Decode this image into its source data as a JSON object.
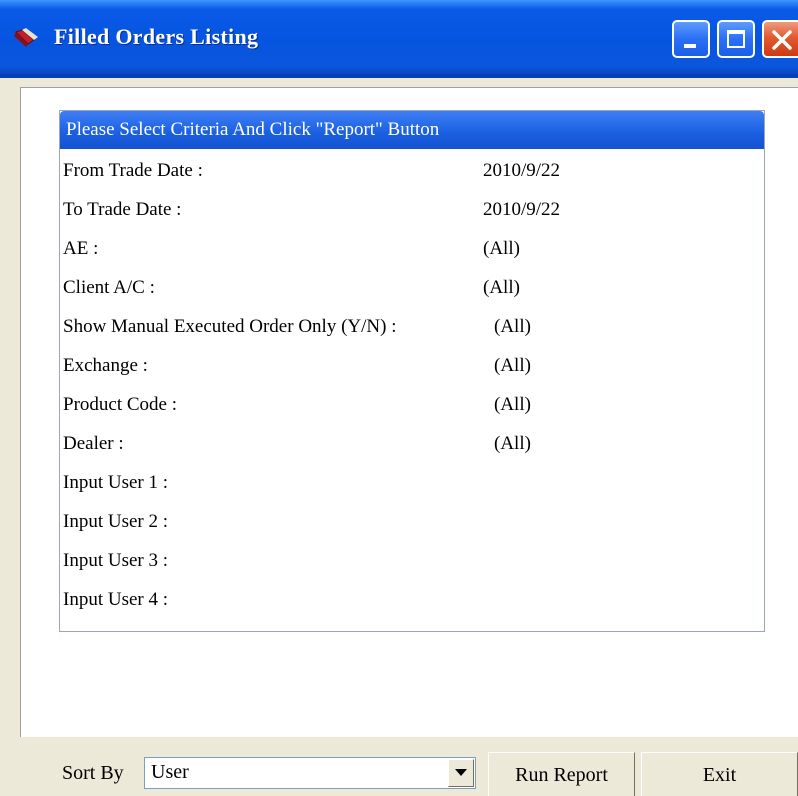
{
  "window": {
    "title": "Filled Orders Listing"
  },
  "criteria": {
    "header": "Please Select Criteria And Click \"Report\" Button",
    "rows": [
      {
        "label": "From Trade Date :",
        "value": "2010/9/22"
      },
      {
        "label": "To Trade Date :",
        "value": "2010/9/22"
      },
      {
        "label": "AE :",
        "value": "(All)"
      },
      {
        "label": "Client A/C :",
        "value": "(All)"
      },
      {
        "label": "Show Manual Executed Order Only (Y/N) :",
        "value": "(All)"
      },
      {
        "label": "Exchange :",
        "value": "(All)"
      },
      {
        "label": "Product Code :",
        "value": "(All)"
      },
      {
        "label": "Dealer :",
        "value": "(All)"
      },
      {
        "label": "Input User 1 :",
        "value": ""
      },
      {
        "label": "Input User 2 :",
        "value": ""
      },
      {
        "label": "Input User 3 :",
        "value": ""
      },
      {
        "label": "Input User 4 :",
        "value": ""
      }
    ]
  },
  "toolbar": {
    "sort_label": "Sort By",
    "sort_value": "User",
    "run_label": "Run Report",
    "exit_label": "Exit"
  },
  "icons": {
    "app": "app-icon",
    "minimize": "minimize-icon",
    "maximize": "maximize-icon",
    "close": "close-icon",
    "dropdown": "chevron-down-icon"
  },
  "colors": {
    "titlebar": "#0655e0",
    "header": "#1a5fe0",
    "close": "#e25a30",
    "face": "#ece9d8"
  }
}
